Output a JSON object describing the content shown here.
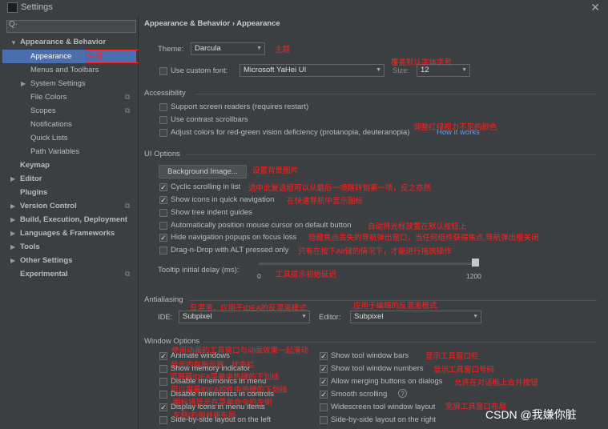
{
  "window": {
    "title": "Settings"
  },
  "search": {
    "placeholder": "Q·"
  },
  "sidebar": {
    "items": [
      {
        "label": "Appearance & Behavior",
        "bold": true
      },
      {
        "label": "Appearance"
      },
      {
        "label": "Menus and Toolbars"
      },
      {
        "label": "System Settings"
      },
      {
        "label": "File Colors"
      },
      {
        "label": "Scopes"
      },
      {
        "label": "Notifications"
      },
      {
        "label": "Quick Lists"
      },
      {
        "label": "Path Variables"
      },
      {
        "label": "Keymap"
      },
      {
        "label": "Editor"
      },
      {
        "label": "Plugins"
      },
      {
        "label": "Version Control"
      },
      {
        "label": "Build, Execution, Deployment"
      },
      {
        "label": "Languages & Frameworks"
      },
      {
        "label": "Tools"
      },
      {
        "label": "Other Settings"
      },
      {
        "label": "Experimental"
      }
    ],
    "selected_annotation": "外观"
  },
  "breadcrumb": {
    "parent": "Appearance & Behavior",
    "sep": "›",
    "current": "Appearance"
  },
  "theme": {
    "label": "Theme:",
    "value": "Darcula",
    "annotation": "主题"
  },
  "font": {
    "label": "Use custom font:",
    "value": "Microsoft YaHei UI",
    "size_label": "Size:",
    "size_value": "12",
    "annotation": "覆盖默认字体字号"
  },
  "accessibility": {
    "title": "Accessibility",
    "screen_readers": "Support screen readers (requires restart)",
    "contrast_scrollbars": "Use contrast scrollbars",
    "red_green": "Adjust colors for red-green vision deficiency (protanopia, deuteranopia)",
    "how_it_works": "How it works",
    "annotation": "调整红绿视力不足的颜色"
  },
  "ui_options": {
    "title": "UI Options",
    "background_button": "Background Image...",
    "background_annotation": "设置背景图片",
    "options": [
      {
        "label": "Cyclic scrolling in list",
        "checked": true,
        "annotation": "选中此复选框可以从最后一项跳转到第一项，反之亦然"
      },
      {
        "label": "Show icons in quick navigation",
        "checked": true,
        "annotation": "在快速导航中显示图标"
      },
      {
        "label": "Show tree indent guides",
        "checked": false,
        "annotation": ""
      },
      {
        "label": "Automatically position mouse cursor on default button",
        "checked": false,
        "annotation": "自动将光标放置在默认按钮上"
      },
      {
        "label": "Hide navigation popups on focus loss",
        "checked": true,
        "annotation": "隐藏焦点丢失的导航弹出窗口，当任何组件获得焦点,导航弹出框关闭"
      },
      {
        "label": "Drag-n-Drop with ALT pressed only",
        "checked": false,
        "annotation": "只有在按下Alt键的情况下，才能进行拖放操作"
      }
    ],
    "tooltip_label": "Tooltip initial delay (ms):",
    "tooltip_min": "0",
    "tooltip_max": "1200",
    "tooltip_fraction": 1.0,
    "tooltip_annotation": "工具提示初始延迟"
  },
  "antialiasing": {
    "title": "Antialiasing",
    "ide_label": "IDE:",
    "ide_value": "Subpixel",
    "ide_annotation": "反混淆，应用于IDEA的反混淆模式",
    "editor_label": "Editor:",
    "editor_value": "Subpixel",
    "editor_annotation": "应用于编辑的反混淆模式"
  },
  "window_options": {
    "title": "Window Options",
    "left": [
      {
        "label": "Animate windows",
        "checked": true,
        "annotation": "使用动画的工具窗口与动画效果一起滑动"
      },
      {
        "label": "Show memory indicator",
        "checked": false,
        "annotation": "显示内存指示器，状态栏"
      },
      {
        "label": "Disable mnemonics in menu",
        "checked": false,
        "annotation": "可屏蔽IDEA菜单中热键的下划线"
      },
      {
        "label": "Disable mnemonics in controls",
        "checked": false,
        "annotation": "可以屏蔽IDEA控件中热键的下划线"
      },
      {
        "label": "Display icons in menu items",
        "checked": true,
        "annotation": "图标将显示在菜单命令的左侧"
      },
      {
        "label": "Side-by-side layout on the left",
        "checked": false,
        "annotation": "左侧/右侧并排布局"
      }
    ],
    "right": [
      {
        "label": "Show tool window bars",
        "checked": true,
        "annotation": "显示工具窗口栏"
      },
      {
        "label": "Show tool window numbers",
        "checked": true,
        "annotation": "显示工具窗口号码"
      },
      {
        "label": "Allow merging buttons on dialogs",
        "checked": true,
        "annotation": "允许在对话框上合并按钮"
      },
      {
        "label": "Smooth scrolling",
        "checked": true,
        "annotation": ""
      },
      {
        "label": "Widescreen tool window layout",
        "checked": false,
        "annotation": "宽屏工具窗口布局"
      },
      {
        "label": "Side-by-side layout on the right",
        "checked": false,
        "annotation": ""
      }
    ]
  },
  "watermark": "CSDN @我嫌你脏",
  "colors": {
    "selection": "#4b6eaf",
    "annotation": "#ff2020",
    "link": "#589df6"
  }
}
